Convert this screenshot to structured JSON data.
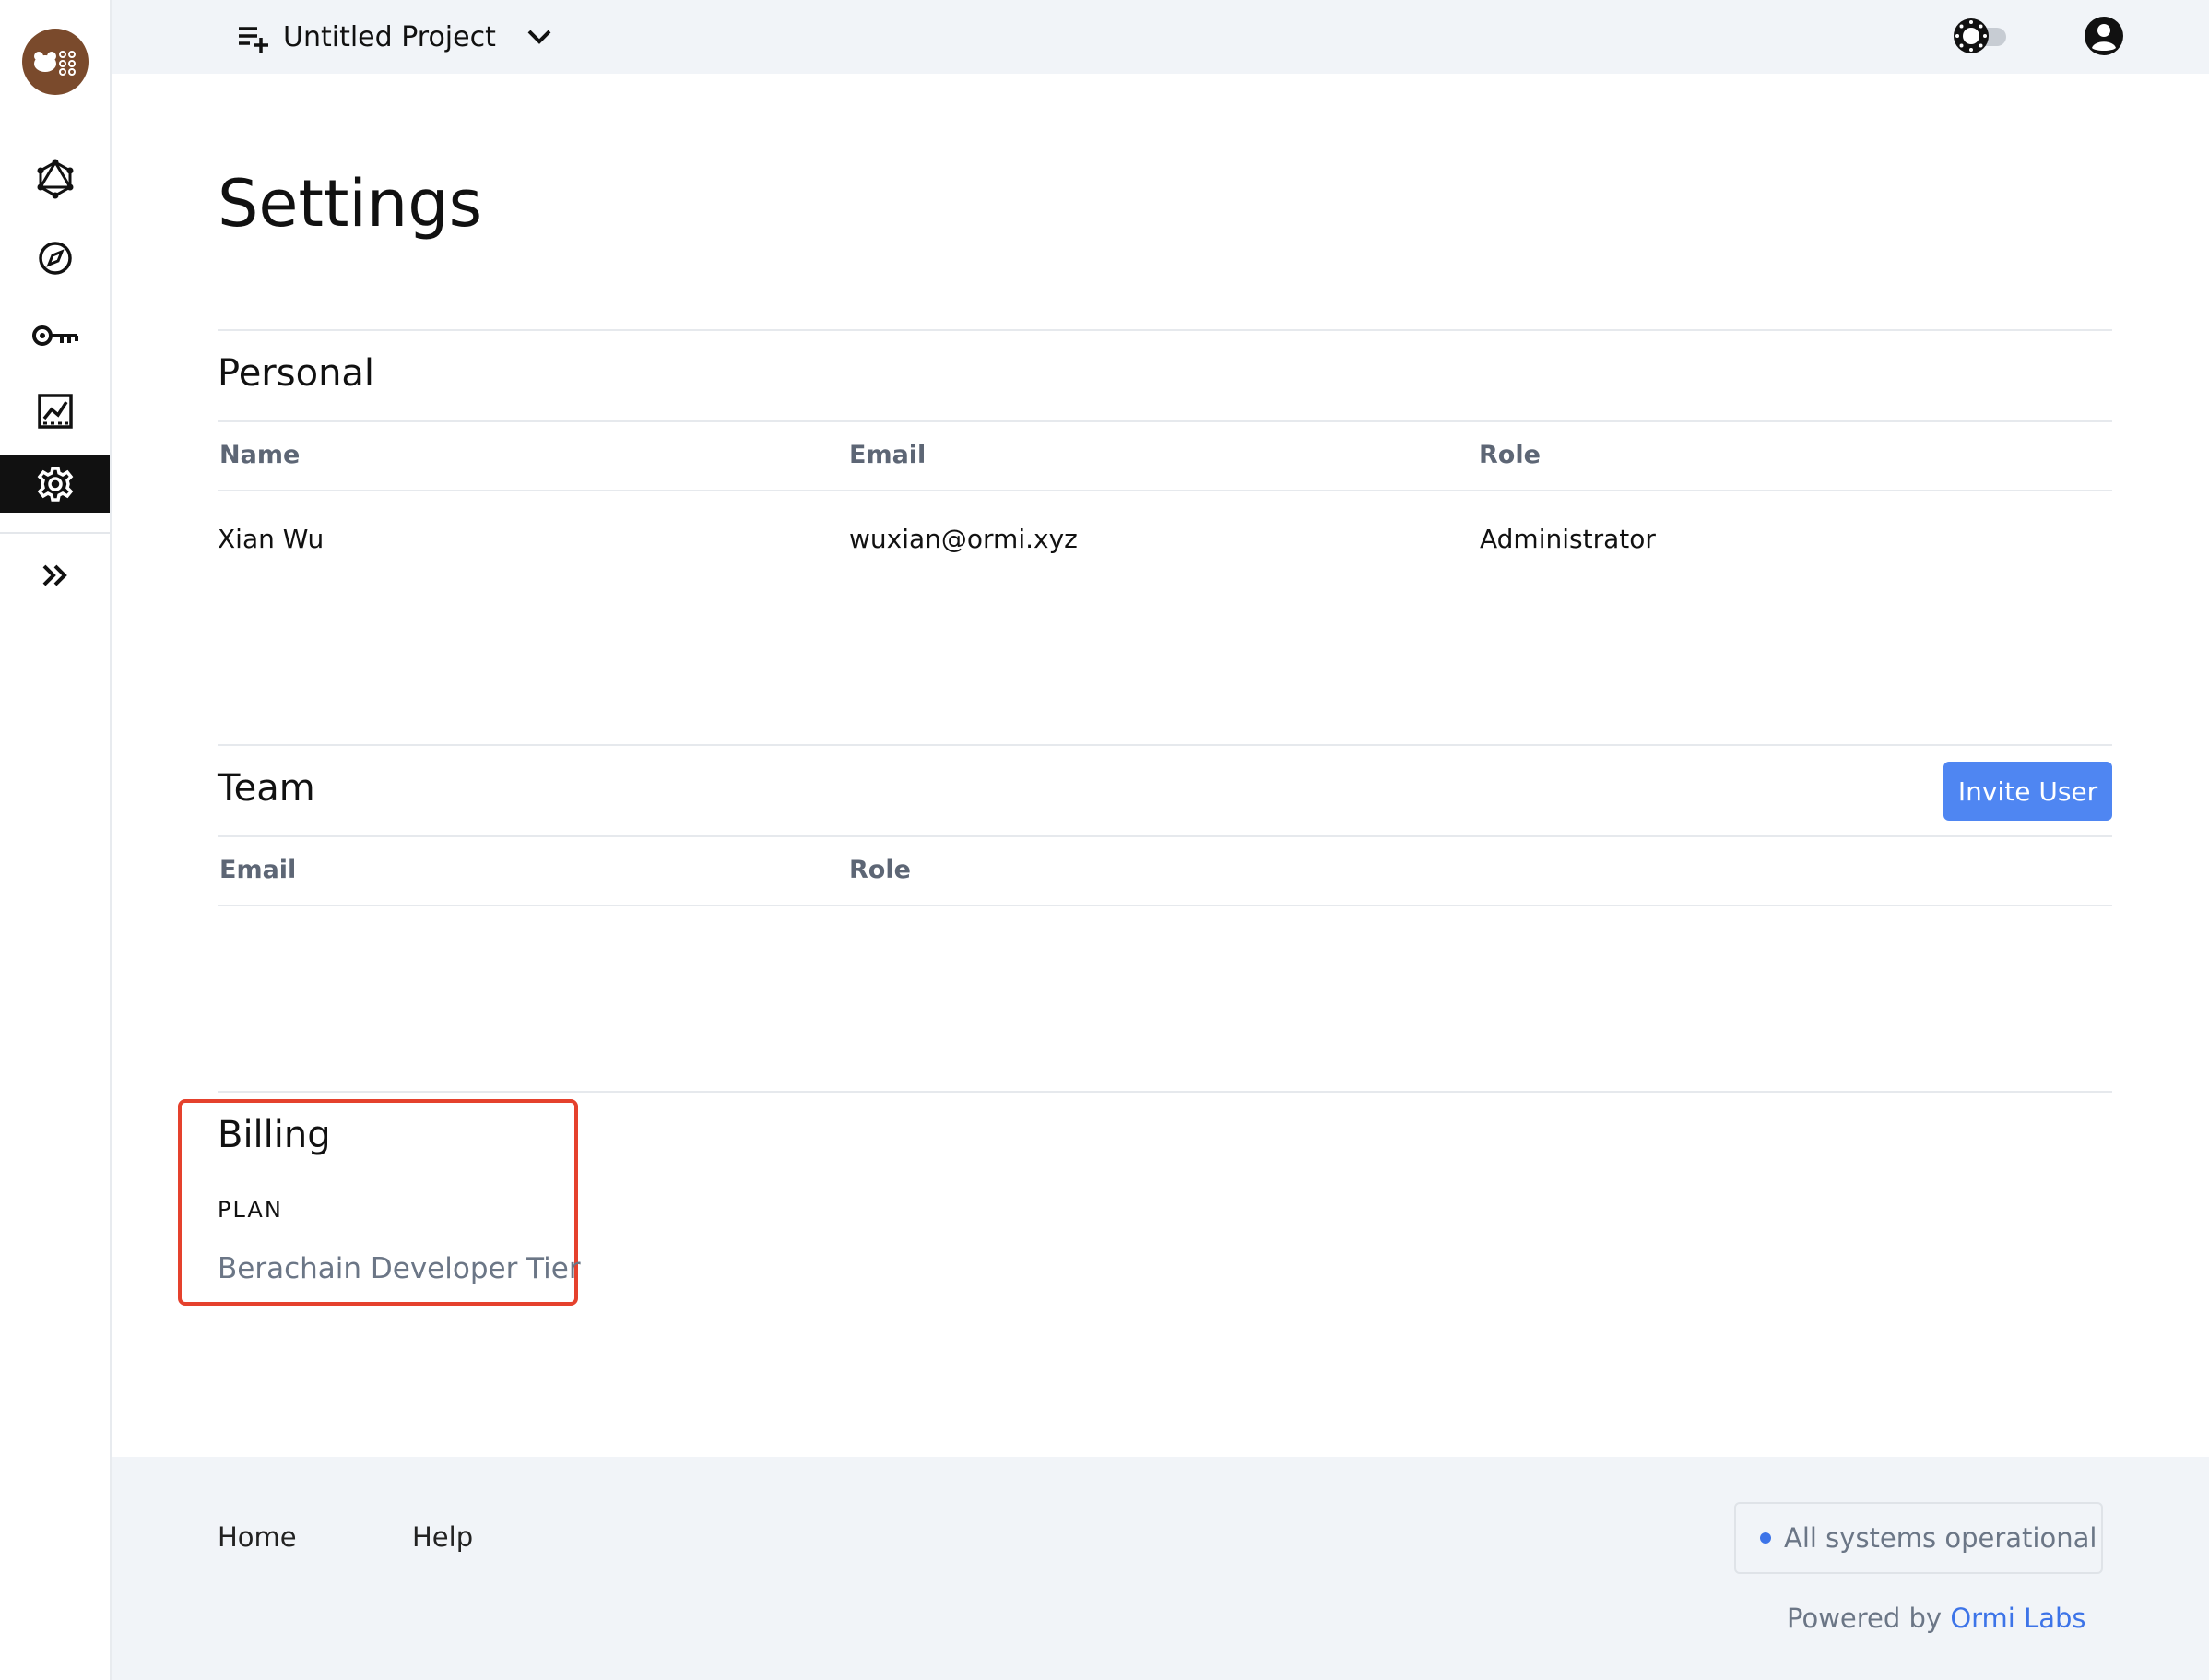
{
  "topbar": {
    "project_name": "Untitled Project"
  },
  "sidebar": {
    "items": [
      {
        "icon": "graphql-icon"
      },
      {
        "icon": "compass-icon"
      },
      {
        "icon": "key-icon"
      },
      {
        "icon": "chart-icon"
      },
      {
        "icon": "gear-icon",
        "active": true
      },
      {
        "icon": "chevrons-right-icon"
      }
    ]
  },
  "page": {
    "title": "Settings"
  },
  "personal": {
    "title": "Personal",
    "columns": [
      "Name",
      "Email",
      "Role"
    ],
    "row": {
      "name": "Xian Wu",
      "email": "wuxian@ormi.xyz",
      "role": "Administrator"
    }
  },
  "team": {
    "title": "Team",
    "invite_label": "Invite User",
    "columns": [
      "Email",
      "Role"
    ]
  },
  "billing": {
    "title": "Billing",
    "plan_label": "PLAN",
    "plan_value": "Berachain Developer Tier"
  },
  "footer": {
    "links": [
      "Home",
      "Help"
    ],
    "status": "All systems operational",
    "powered_prefix": "Powered by",
    "powered_brand": "Ormi Labs"
  },
  "colors": {
    "accent": "#4f86f2",
    "highlight_box": "#e5412d",
    "logo_bg": "#7a4a2c"
  }
}
